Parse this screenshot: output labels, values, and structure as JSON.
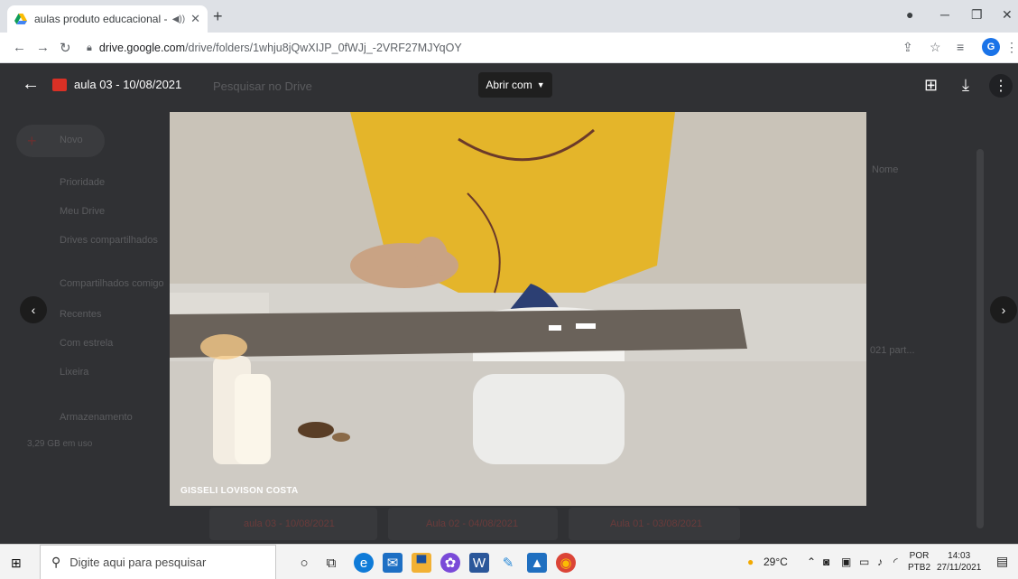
{
  "browser": {
    "tab_title": "aulas produto educacional -",
    "tab_audio_icon": "speaker-icon",
    "tab_close": "✕",
    "new_tab": "+",
    "url_host": "drive.google.com",
    "url_path": "/drive/folders/1whju8jQwXIJP_0fWJj_-2VRF27MJYqOY",
    "profile_initial": "G",
    "colors": {
      "tab_bg": "#dee1e6",
      "accent": "#1a73e8"
    }
  },
  "drive_background": {
    "search_placeholder": "Pesquisar no Drive",
    "new_button": "Novo",
    "sidebar": [
      "Prioridade",
      "Meu Drive",
      "Drives compartilhados",
      "Compartilhados comigo",
      "Recentes",
      "Com estrela",
      "Lixeira",
      "Armazenamento"
    ],
    "storage_used": "3,29 GB em uso",
    "sort_label": "Nome",
    "partial_file": "021 part...",
    "files": [
      "aula 03 - 10/08/2021",
      "Aula 02 - 04/08/2021",
      "Aula 01 - 03/08/2021"
    ]
  },
  "viewer": {
    "title": "aula 03 - 10/08/2021",
    "open_with": "Abrir com",
    "video_caption": "GISSELI LOVISON COSTA"
  },
  "taskbar": {
    "search_placeholder": "Digite aqui para pesquisar",
    "weather": "29°C",
    "lang_top": "POR",
    "lang_bottom": "PTB2",
    "time": "14:03",
    "date": "27/11/2021"
  }
}
